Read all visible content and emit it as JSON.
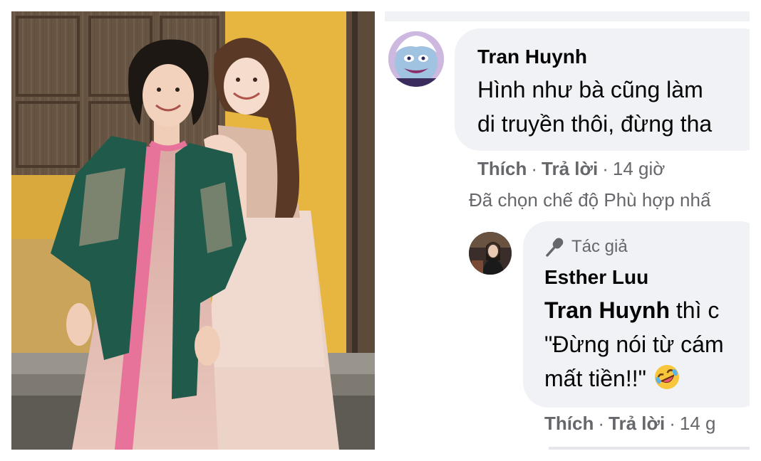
{
  "comment_1": {
    "author": "Tran Huynh",
    "line_1": "Hình như bà cũng làm",
    "line_2": "di truyền thôi, đừng tha",
    "like": "Thích",
    "reply": "Trả lời",
    "time": "14 giờ",
    "separator": "·"
  },
  "filter_note": "Đã chọn chế độ Phù hợp nhấ",
  "comment_2": {
    "badge": "Tác giả",
    "author": "Esther Luu",
    "mention": "Tran Huynh",
    "line_1_rest": " thì c",
    "line_2": "\"Đừng nói từ cám",
    "line_3": "mất tiền!!\"",
    "emoji": "rolling-on-floor-laughing",
    "like": "Thích",
    "reply": "Trả lời",
    "time": "14 g",
    "separator": "·"
  },
  "colors": {
    "bubble": "#f0f2f5",
    "text": "#050505",
    "secondary": "#65676b"
  }
}
